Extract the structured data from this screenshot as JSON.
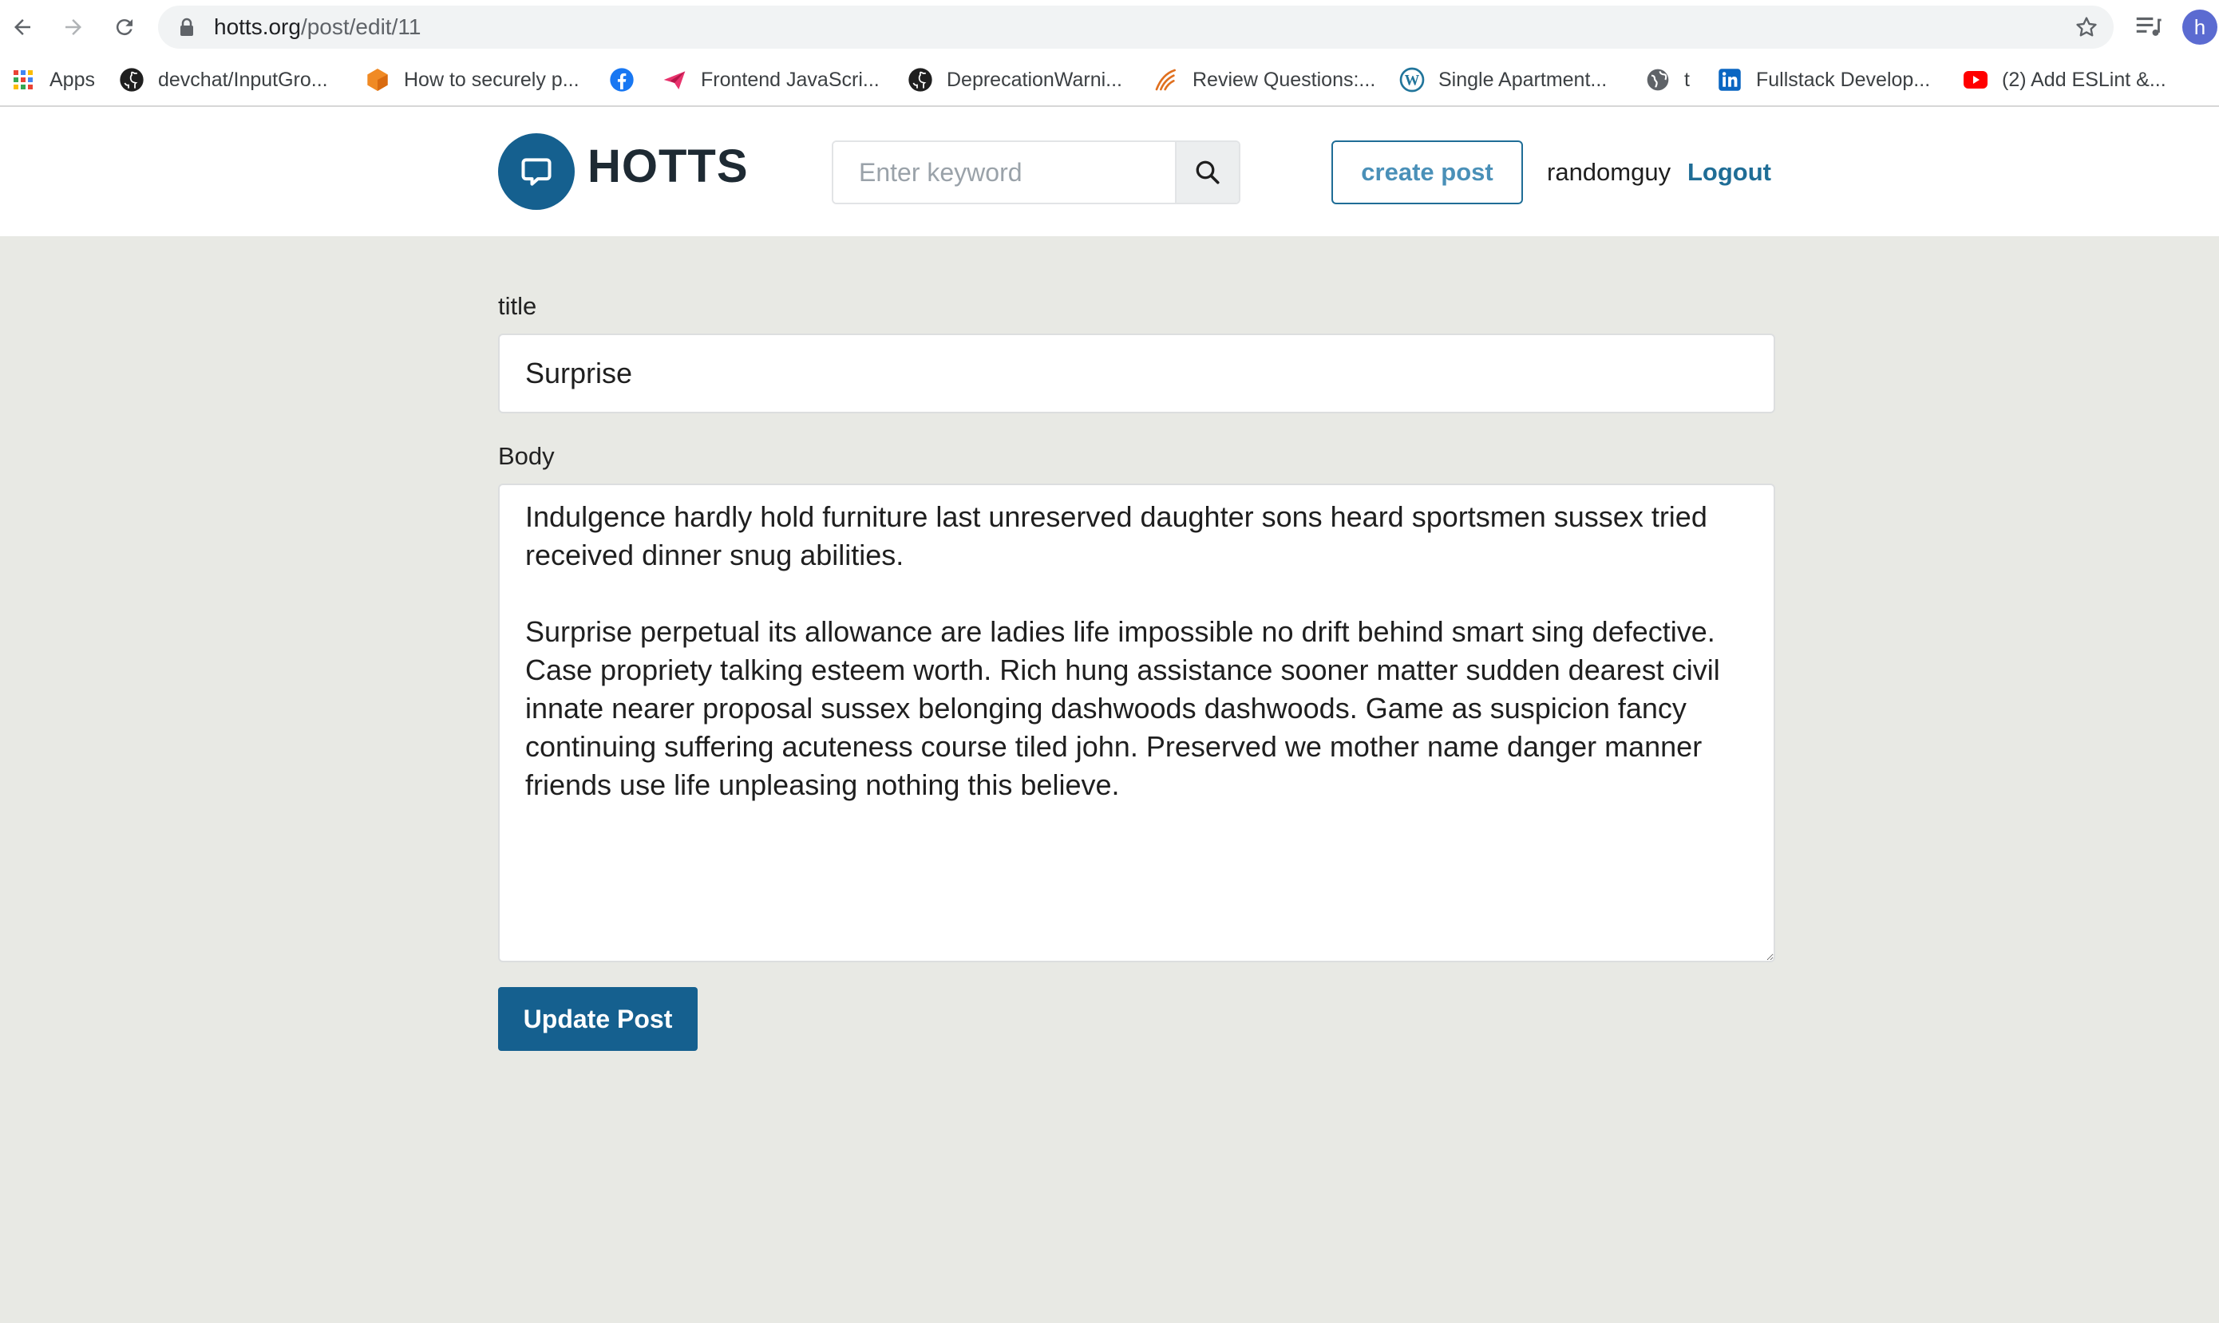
{
  "browser": {
    "url_host": "hotts.org",
    "url_path": "/post/edit/11",
    "profile_initial": "h",
    "bookmarks": [
      {
        "label": "Apps",
        "icon": "apps-grid-icon"
      },
      {
        "label": "devchat/InputGro...",
        "icon": "github-icon"
      },
      {
        "label": "How to securely p...",
        "icon": "hexagon-icon"
      },
      {
        "label": "",
        "icon": "facebook-icon"
      },
      {
        "label": "Frontend JavaScri...",
        "icon": "paper-plane-icon"
      },
      {
        "label": "DeprecationWarni...",
        "icon": "github-icon"
      },
      {
        "label": "Review Questions:...",
        "icon": "feather-icon"
      },
      {
        "label": "Single Apartment...",
        "icon": "wordpress-icon"
      },
      {
        "label": "t",
        "icon": "globe-icon"
      },
      {
        "label": "Fullstack Develop...",
        "icon": "linkedin-icon"
      },
      {
        "label": "(2) Add ESLint &...",
        "icon": "youtube-icon"
      }
    ]
  },
  "header": {
    "logo_text": "HOTTS",
    "search_placeholder": "Enter keyword",
    "create_label": "create post",
    "username": "randomguy",
    "logout_label": "Logout"
  },
  "form": {
    "title_label": "title",
    "title_value": "Surprise",
    "body_label": "Body",
    "body_value": "Indulgence hardly hold furniture last unreserved daughter sons heard sportsmen sussex tried received dinner snug abilities.\n\nSurprise perpetual its allowance are ladies life impossible no drift behind smart sing defective. Case propriety talking esteem worth. Rich hung assistance sooner matter sudden dearest civil innate nearer proposal sussex belonging dashwoods dashwoods. Game as suspicion fancy continuing suffering acuteness course tiled john. Preserved we mother name danger manner friends use life unpleasing nothing this believe.",
    "submit_label": "Update Post"
  },
  "colors": {
    "brand": "#15608f",
    "page_bg": "#e8e9e4"
  }
}
